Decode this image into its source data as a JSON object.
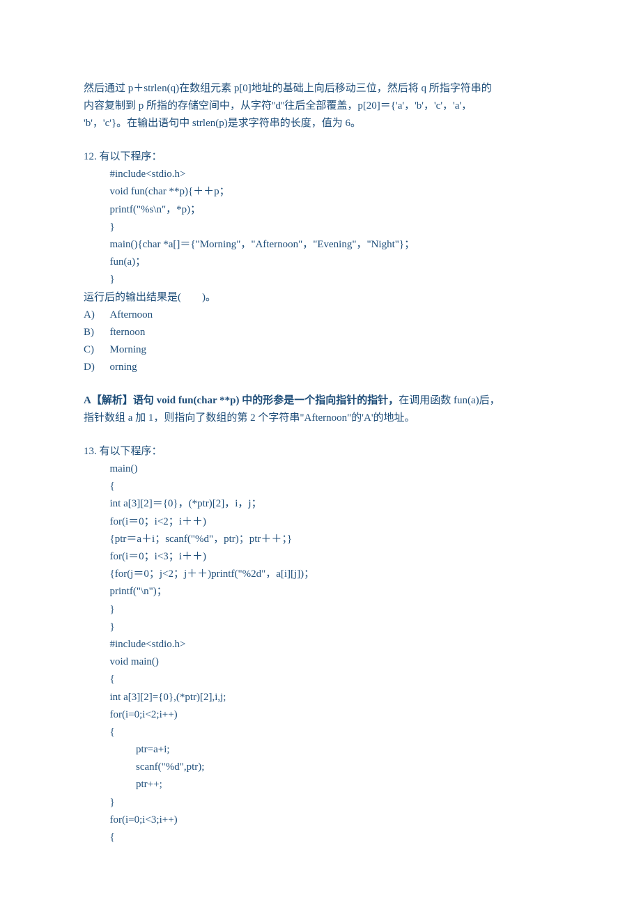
{
  "intro": {
    "l1": "然后通过 p＋strlen(q)在数组元素 p[0]地址的基础上向后移动三位，然后将 q 所指字符串的",
    "l2": "内容复制到 p 所指的存储空间中，从字符''d''往后全部覆盖，p[20]＝{'a'，'b'，'c'，'a'，",
    "l3": "'b'，'c'}。在输出语句中 strlen(p)是求字符串的长度，值为 6。"
  },
  "q12": {
    "header": "12. 有以下程序：",
    "code": [
      "#include<stdio.h>",
      "void fun(char **p){＋＋p；",
      "printf(\"%s\\n\"，*p)；",
      "}",
      "main(){char *a[]＝{\"Morning\"，\"Afternoon\"，\"Evening\"，\"Night\"}；",
      "fun(a)；",
      "}"
    ],
    "prompt": "运行后的输出结果是(　　)。",
    "options": [
      {
        "letter": "A)",
        "text": "Afternoon"
      },
      {
        "letter": "B)",
        "text": "fternoon"
      },
      {
        "letter": "C)",
        "text": "Morning"
      },
      {
        "letter": "D)",
        "text": "orning"
      }
    ],
    "answer": {
      "bold_prefix": "A【解析】语句 void fun(char **p) 中的形参是一个指向指针的指针，",
      "rest_l1": "在调用函数 fun(a)后，",
      "rest_l2": "指针数组 a 加 1，则指向了数组的第 2 个字符串\"Afternoon\"的'A'的地址。"
    }
  },
  "q13": {
    "header": "13. 有以下程序：",
    "code_a": [
      "main()",
      "{",
      "int a[3][2]＝{0}，(*ptr)[2]，i，j；",
      "for(i＝0；i<2；i＋＋)",
      "{ptr＝a＋i；scanf(\"%d\"，ptr)；ptr＋＋；}",
      "for(i＝0；i<3；i＋＋)",
      "{for(j＝0；j<2；j＋＋)printf(\"%2d\"，a[i][j])；",
      "printf(\"\\n\")；",
      "}",
      "}"
    ],
    "code_b": {
      "inc": "#include<stdio.h>",
      "voidmain": "void main()",
      "ob": "{",
      "l1": "int a[3][2]={0},(*ptr)[2],i,j;",
      "l2": "for(i=0;i<2;i++)",
      "l3": "{",
      "l4": "ptr=a+i;",
      "l5": "scanf(\"%d\",ptr);",
      "l6": "ptr++;",
      "l7": "}",
      "l8": "for(i=0;i<3;i++)",
      "l9": "{"
    }
  }
}
